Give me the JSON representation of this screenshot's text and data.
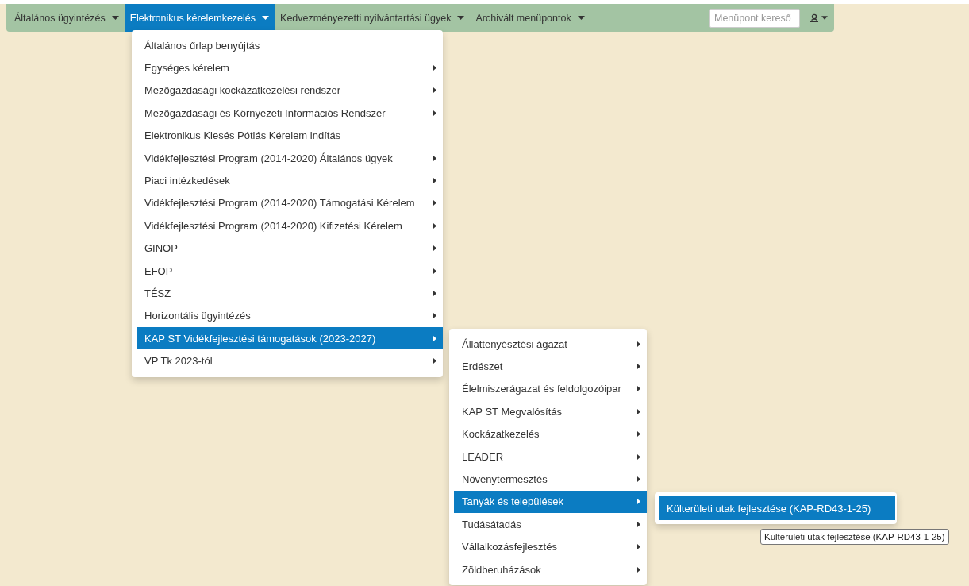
{
  "navbar": {
    "items": [
      {
        "label": "Általános ügyintézés",
        "selected": false
      },
      {
        "label": "Elektronikus kérelemkezelés",
        "selected": true
      },
      {
        "label": "Kedvezményezetti nyilvántartási ügyek",
        "selected": false
      },
      {
        "label": "Archivált menüpontok",
        "selected": false
      }
    ],
    "search": {
      "placeholder": "Menüpont kereső"
    }
  },
  "menus": [
    {
      "items": [
        {
          "label": "Általános űrlap benyújtás",
          "submenu": false,
          "selected": false
        },
        {
          "label": "Egységes kérelem",
          "submenu": true,
          "selected": false
        },
        {
          "label": "Mezőgazdasági kockázatkezelési rendszer",
          "submenu": true,
          "selected": false
        },
        {
          "label": "Mezőgazdasági és Környezeti Információs Rendszer",
          "submenu": true,
          "selected": false
        },
        {
          "label": "Elektronikus Kiesés Pótlás Kérelem indítás",
          "submenu": false,
          "selected": false
        },
        {
          "label": "Vidékfejlesztési Program (2014-2020) Általános ügyek",
          "submenu": true,
          "selected": false
        },
        {
          "label": "Piaci intézkedések",
          "submenu": true,
          "selected": false
        },
        {
          "label": "Vidékfejlesztési Program (2014-2020) Támogatási Kérelem",
          "submenu": true,
          "selected": false
        },
        {
          "label": "Vidékfejlesztési Program (2014-2020) Kifizetési Kérelem",
          "submenu": true,
          "selected": false
        },
        {
          "label": "GINOP",
          "submenu": true,
          "selected": false
        },
        {
          "label": "EFOP",
          "submenu": true,
          "selected": false
        },
        {
          "label": "TÉSZ",
          "submenu": true,
          "selected": false
        },
        {
          "label": "Horizontális ügyintézés",
          "submenu": true,
          "selected": false
        },
        {
          "label": "KAP ST Vidékfejlesztési támogatások (2023-2027)",
          "submenu": true,
          "selected": true
        },
        {
          "label": "VP Tk 2023-tól",
          "submenu": true,
          "selected": false
        }
      ]
    },
    {
      "items": [
        {
          "label": "Állattenyésztési ágazat",
          "submenu": true,
          "selected": false
        },
        {
          "label": "Erdészet",
          "submenu": true,
          "selected": false
        },
        {
          "label": "Élelmiszerágazat és feldolgozóipar",
          "submenu": true,
          "selected": false
        },
        {
          "label": "KAP ST Megvalósítás",
          "submenu": true,
          "selected": false
        },
        {
          "label": "Kockázatkezelés",
          "submenu": true,
          "selected": false
        },
        {
          "label": "LEADER",
          "submenu": true,
          "selected": false
        },
        {
          "label": "Növénytermesztés",
          "submenu": true,
          "selected": false
        },
        {
          "label": "Tanyák és települések",
          "submenu": true,
          "selected": true
        },
        {
          "label": "Tudásátadás",
          "submenu": true,
          "selected": false
        },
        {
          "label": "Vállalkozásfejlesztés",
          "submenu": true,
          "selected": false
        },
        {
          "label": "Zöldberuházások",
          "submenu": true,
          "selected": false
        }
      ]
    },
    {
      "items": [
        {
          "label": "Külterületi utak fejlesztése (KAP-RD43-1-25)",
          "submenu": false,
          "selected": true
        }
      ]
    }
  ],
  "tooltip": "Külterületi utak fejlesztése (KAP-RD43-1-25)"
}
